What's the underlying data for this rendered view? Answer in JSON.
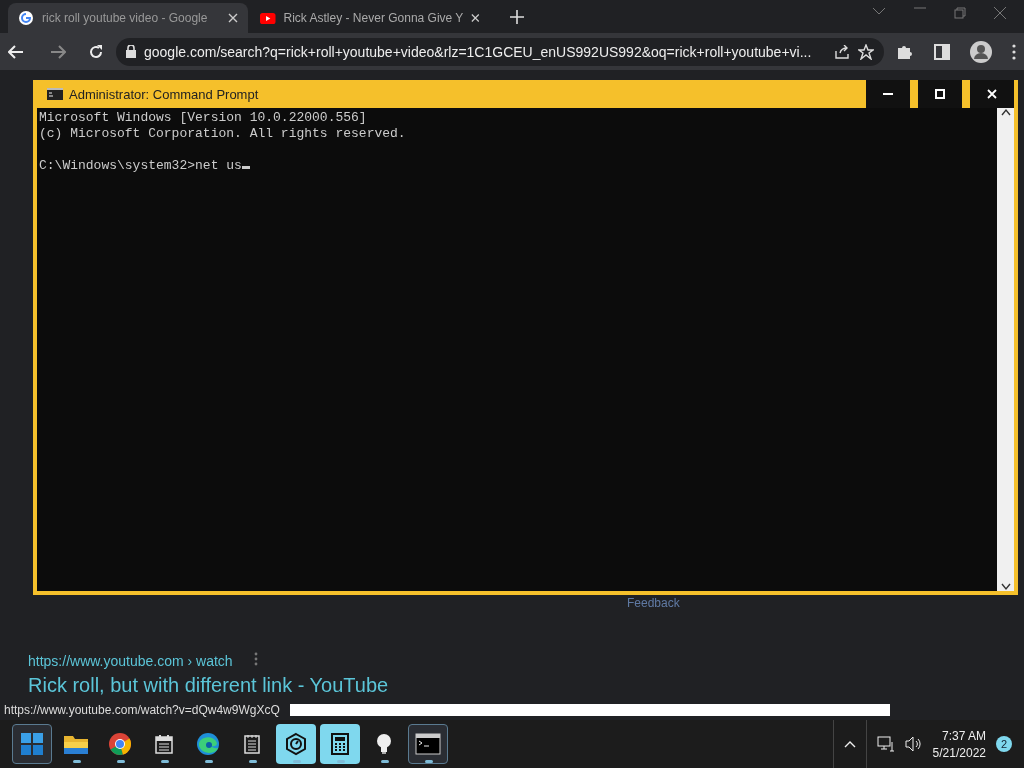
{
  "browser": {
    "tabs": [
      {
        "title": "rick roll youtube video - Google",
        "selected": true
      },
      {
        "title": "Rick Astley - Never Gonna Give Y",
        "selected": false
      }
    ],
    "address": "google.com/search?q=rick+roll+youtube+video&rlz=1C1GCEU_enUS992US992&oq=rick+roll+youtube+vi...",
    "page": {
      "feedback": "Feedback",
      "result": {
        "url": "https://www.youtube.com › watch",
        "title": "Rick roll, but with different link - YouTube"
      }
    },
    "status_link": "https://www.youtube.com/watch?v=dQw4w9WgXcQ"
  },
  "console": {
    "title": "Administrator: Command Prompt",
    "header": [
      "Microsoft Windows [Version 10.0.22000.556]",
      "(c) Microsoft Corporation. All rights reserved."
    ],
    "prompt": "C:\\Windows\\system32>net us"
  },
  "taskbar": {
    "apps": [
      {
        "kind": "start",
        "running": false,
        "highlighted": false,
        "active": true
      },
      {
        "kind": "folder",
        "running": true,
        "highlighted": false,
        "active": false
      },
      {
        "kind": "chrome",
        "running": true,
        "highlighted": false,
        "active": false
      },
      {
        "kind": "calendar",
        "running": true,
        "highlighted": false,
        "active": false
      },
      {
        "kind": "edge",
        "running": true,
        "highlighted": false,
        "active": false
      },
      {
        "kind": "notepad",
        "running": true,
        "highlighted": false,
        "active": false
      },
      {
        "kind": "clock",
        "running": true,
        "highlighted": true,
        "active": false
      },
      {
        "kind": "calculator",
        "running": true,
        "highlighted": true,
        "active": false
      },
      {
        "kind": "bulb",
        "running": true,
        "highlighted": false,
        "active": false
      },
      {
        "kind": "terminal",
        "running": true,
        "highlighted": false,
        "active": true
      }
    ],
    "time": "7:37 AM",
    "date": "5/21/2022",
    "notifications": "2"
  }
}
